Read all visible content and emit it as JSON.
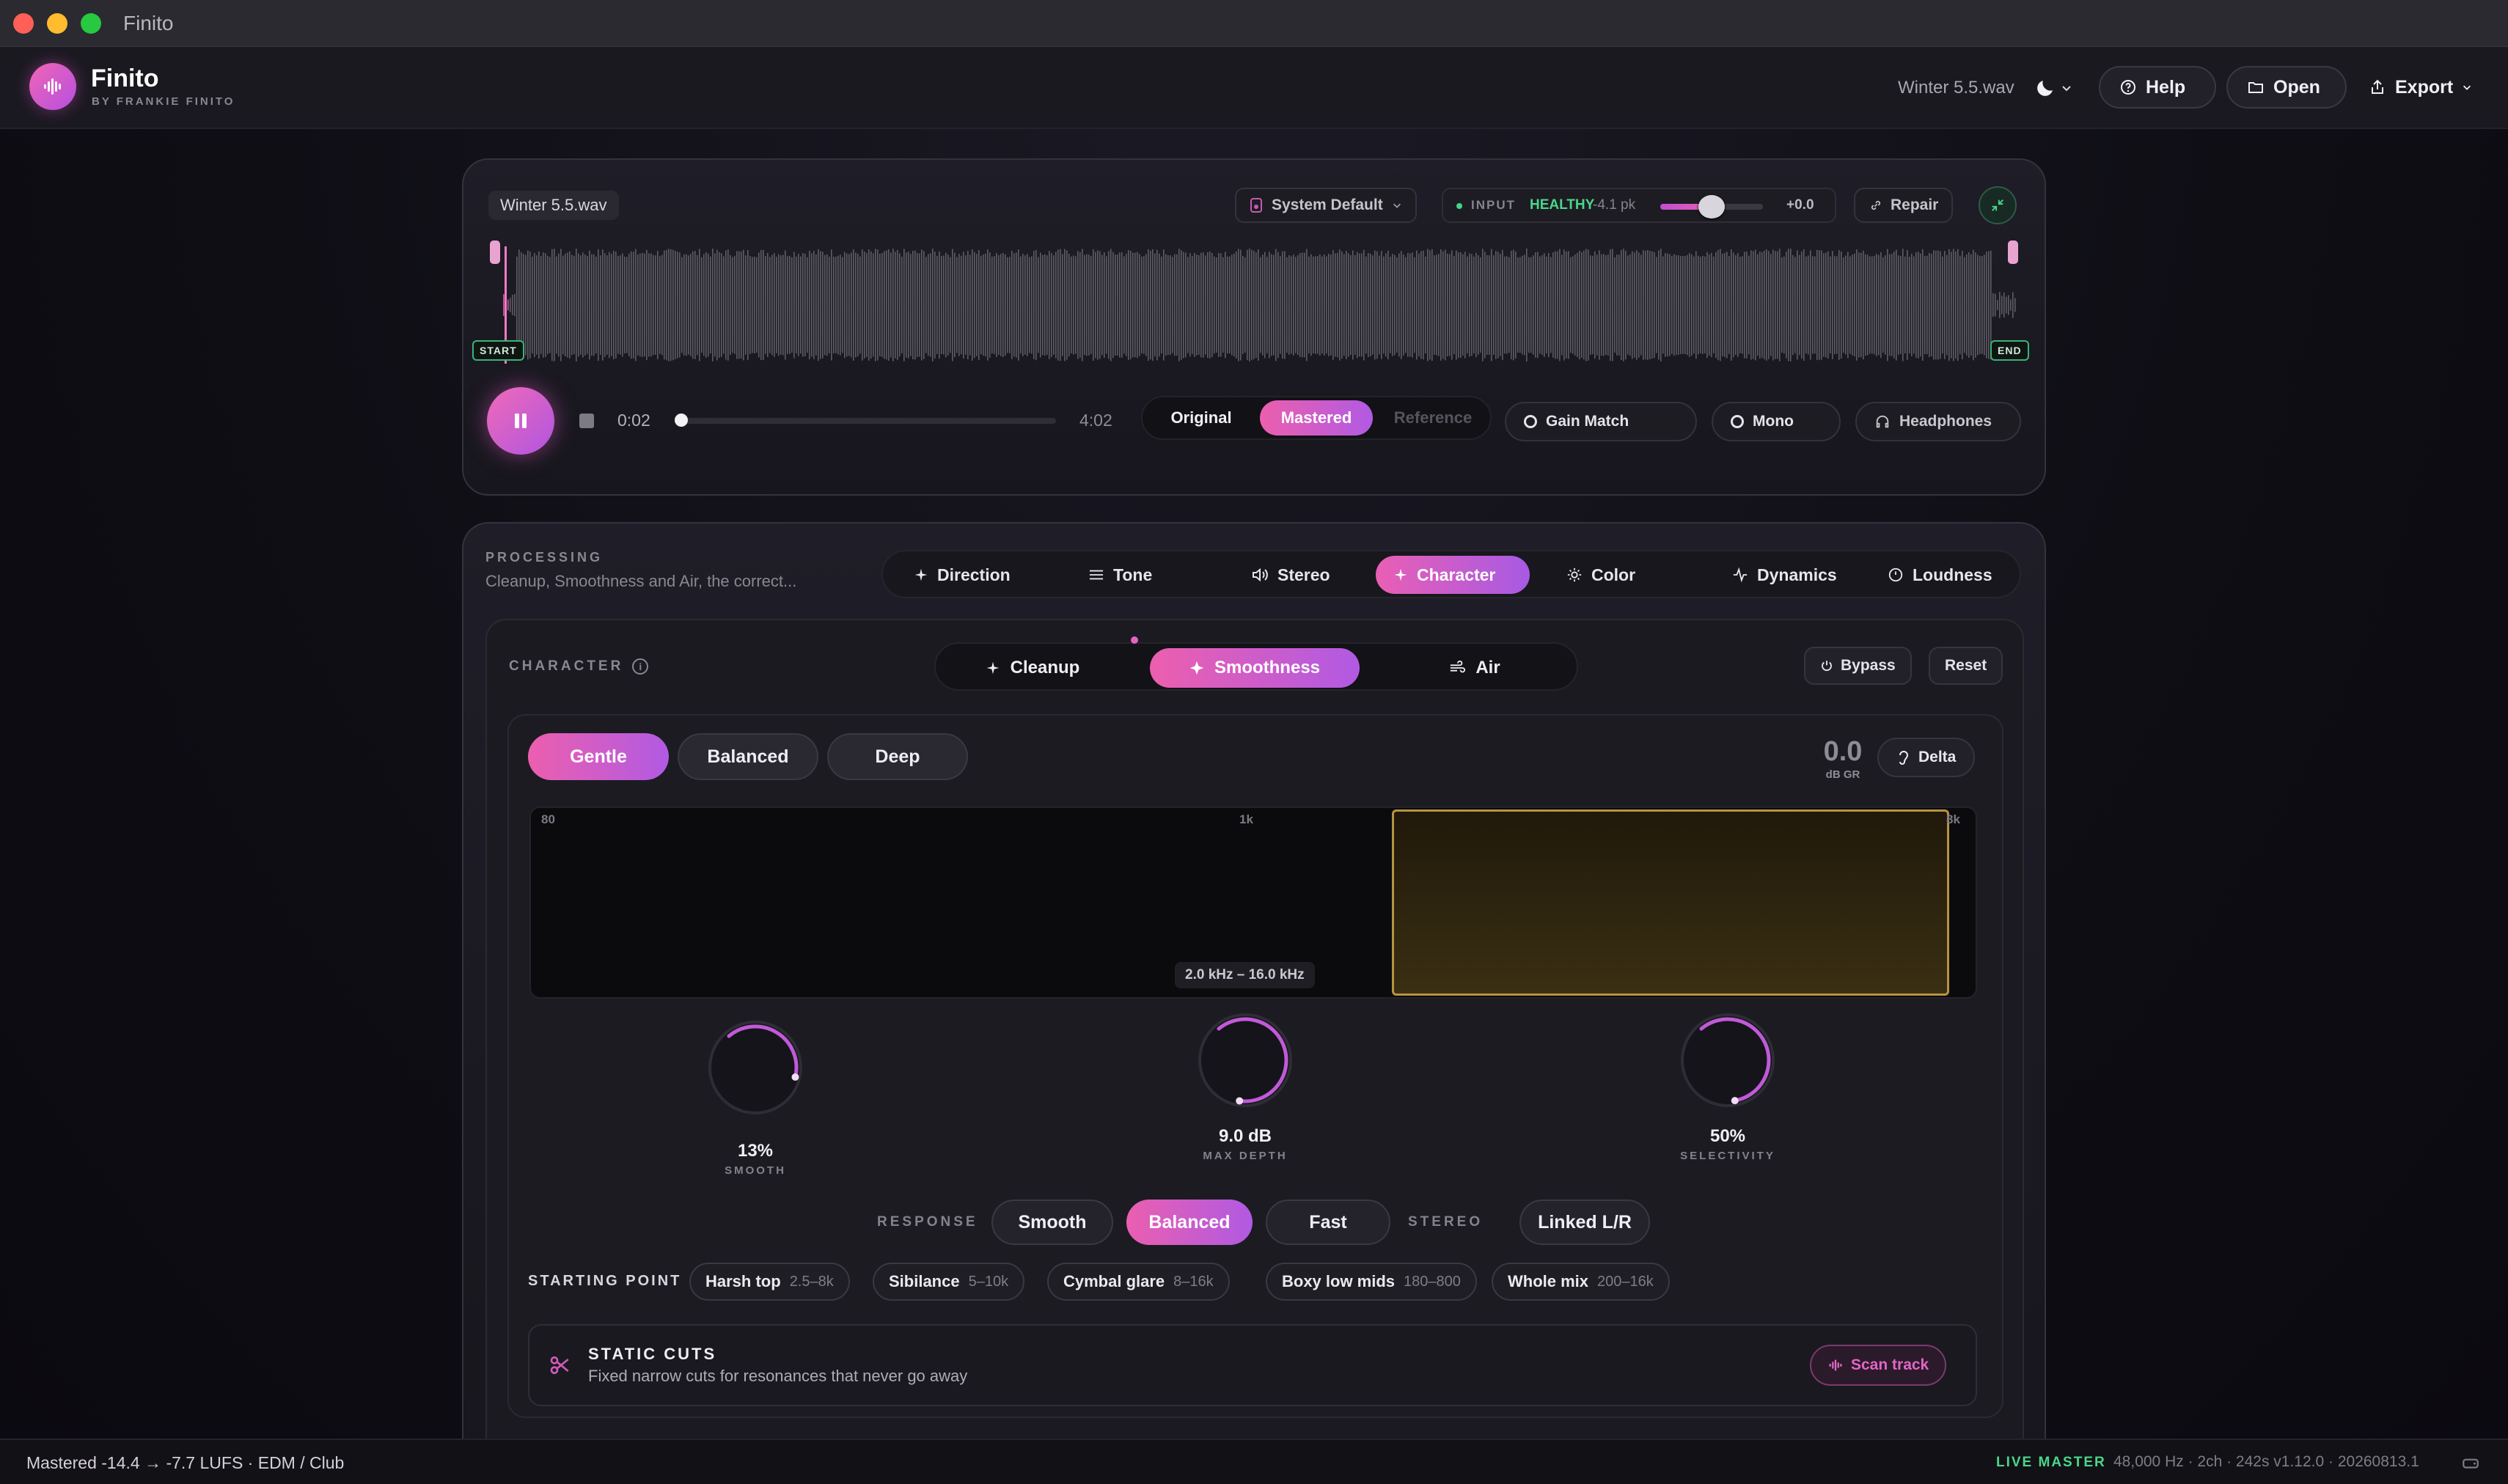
{
  "window": {
    "title": "Finito"
  },
  "header": {
    "brand": "Finito",
    "brand_sub": "BY FRANKIE FINITO",
    "file": "Winter 5.5.wav",
    "help": "Help",
    "open": "Open",
    "export": "Export"
  },
  "player": {
    "file": "Winter 5.5.wav",
    "output_device": "System Default",
    "input_label": "INPUT",
    "input_status": "HEALTHY",
    "input_peak": "-4.1 pk",
    "input_gain": "+0.0",
    "input_gain_level": 0.5,
    "repair": "Repair",
    "start": "START",
    "end": "END",
    "time_current": "0:02",
    "time_total": "4:02",
    "progress": 0.008,
    "compare": [
      "Original",
      "Mastered",
      "Reference"
    ],
    "compare_selected": "Mastered",
    "gain_match": "Gain Match",
    "mono": "Mono",
    "headphones": "Headphones"
  },
  "processing": {
    "heading": "PROCESSING",
    "subtitle": "Cleanup, Smoothness and Air, the correct...",
    "tabs": [
      "Direction",
      "Tone",
      "Stereo",
      "Character",
      "Color",
      "Dynamics",
      "Loudness"
    ],
    "active_tab": "Character"
  },
  "character": {
    "heading": "CHARACTER",
    "subtabs": [
      "Cleanup",
      "Smoothness",
      "Air"
    ],
    "active_subtab": "Smoothness",
    "bypass": "Bypass",
    "reset": "Reset",
    "modes": [
      "Gentle",
      "Balanced",
      "Deep"
    ],
    "active_mode": "Gentle",
    "gr_value": "0.0",
    "gr_label": "dB GR",
    "delta": "Delta",
    "spectrum": {
      "ticks": [
        "80",
        "1k",
        "8k"
      ],
      "band_label": "2.0 kHz – 16.0 kHz"
    },
    "knobs": [
      {
        "value": "13%",
        "label": "SMOOTH",
        "level": 0.13
      },
      {
        "value": "9.0 dB",
        "label": "MAX DEPTH",
        "level": 0.6
      },
      {
        "value": "50%",
        "label": "SELECTIVITY",
        "level": 0.5
      }
    ],
    "response_label": "RESPONSE",
    "response": [
      "Smooth",
      "Balanced",
      "Fast"
    ],
    "active_response": "Balanced",
    "stereo_label": "STEREO",
    "stereo": "Linked L/R",
    "starting_point_label": "STARTING POINT",
    "presets": [
      {
        "name": "Harsh top",
        "range": "2.5–8k"
      },
      {
        "name": "Sibilance",
        "range": "5–10k"
      },
      {
        "name": "Cymbal glare",
        "range": "8–16k"
      },
      {
        "name": "Boxy low mids",
        "range": "180–800"
      },
      {
        "name": "Whole mix",
        "range": "200–16k"
      }
    ],
    "static_title": "STATIC CUTS",
    "static_desc": "Fixed narrow cuts for resonances that never go away",
    "scan": "Scan track"
  },
  "status": {
    "left": "Mastered  -14.4 → -7.7 LUFS · EDM / Club",
    "live": "LIVE MASTER",
    "right": "48,000 Hz · 2ch · 242s   v1.12.0 · 20260813.1"
  },
  "colors": {
    "accent_pink": "#e95fb4",
    "accent_purple": "#a75ae4",
    "healthy": "#4bd68a",
    "band": "#b79341"
  }
}
